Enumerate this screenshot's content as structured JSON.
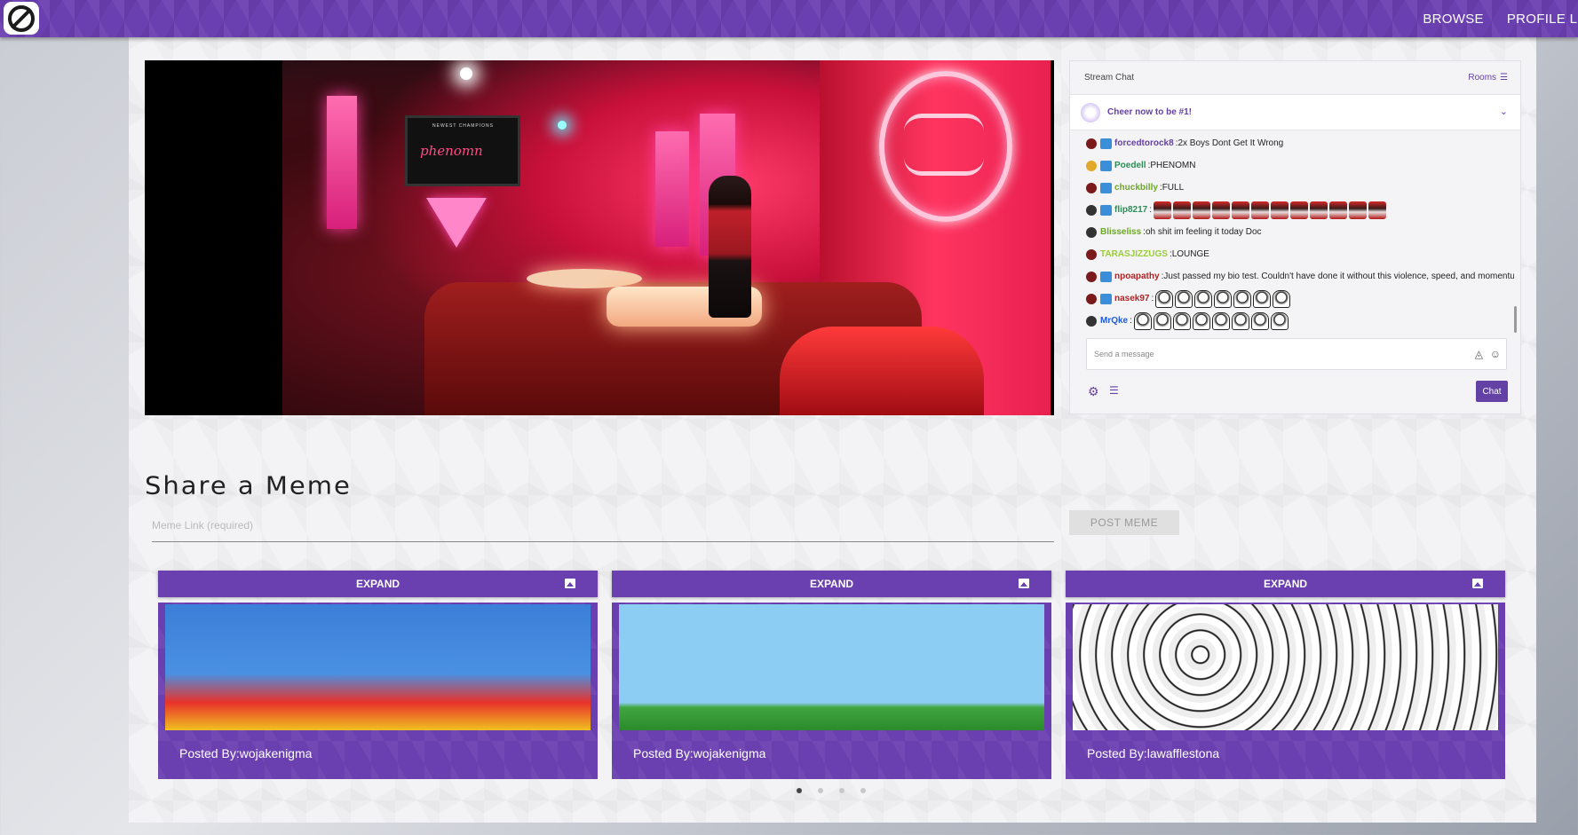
{
  "nav": {
    "browse": "BROWSE",
    "profile": "PROFILE LIS"
  },
  "video": {
    "tv_caption": "NEWEST CHAMPIONS",
    "tv_text": "phenomn"
  },
  "chat": {
    "title": "Stream Chat",
    "rooms": "Rooms",
    "cheer": "Cheer now to be #1!",
    "messages": [
      {
        "user": "forcedtorock8",
        "color": "#6441a4",
        "text": "2x Boys Dont Get It Wrong",
        "emotes": 0,
        "emote_type": "",
        "sub": true,
        "avatar": "#7a1a1a"
      },
      {
        "user": "Poedell",
        "color": "#2e8b57",
        "text": "PHENOMN",
        "emotes": 0,
        "emote_type": "",
        "sub": true,
        "avatar": "#e2a82a"
      },
      {
        "user": "chuckbilly",
        "color": "#6ca824",
        "text": "FULL",
        "emotes": 0,
        "emote_type": "",
        "sub": true,
        "avatar": "#7a1a1a"
      },
      {
        "user": "flip8217",
        "color": "#2e8b57",
        "text": "",
        "emotes": 12,
        "emote_type": "doc",
        "sub": true,
        "avatar": "#333"
      },
      {
        "user": "Blisseliss",
        "color": "#6ca824",
        "text": "oh shit im feeling it today Doc",
        "emotes": 0,
        "emote_type": "",
        "sub": false,
        "avatar": "#333"
      },
      {
        "user": "TARASJIZZUGS",
        "color": "#9acd32",
        "text": "LOUNGE",
        "emotes": 0,
        "emote_type": "",
        "sub": false,
        "avatar": "#7a1a1a"
      },
      {
        "user": "npoapathy",
        "color": "#b22222",
        "text": "Just passed my bio test. Couldn't have done it without this violence, speed, and momentum",
        "emotes": 0,
        "emote_type": "",
        "sub": true,
        "avatar": "#7a1a1a"
      },
      {
        "user": "nasek97",
        "color": "#b22222",
        "text": "",
        "emotes": 7,
        "emote_type": "face",
        "sub": true,
        "avatar": "#7a1a1a"
      },
      {
        "user": "MrQke",
        "color": "#1e5ad6",
        "text": "",
        "emotes": 8,
        "emote_type": "face",
        "sub": false,
        "avatar": "#333"
      }
    ],
    "input_placeholder": "Send a message",
    "send_label": "Chat"
  },
  "share": {
    "title": "Share a Meme",
    "placeholder": "Meme Link (required)",
    "post_label": "POST MEME"
  },
  "cards": [
    {
      "expand": "EXPAND",
      "posted": "Posted By:wojakenigma"
    },
    {
      "expand": "EXPAND",
      "posted": "Posted By:wojakenigma"
    },
    {
      "expand": "EXPAND",
      "posted": "Posted By:lawafflestona"
    }
  ],
  "pagination": {
    "pages": 4,
    "active": 1
  },
  "colors": {
    "brand": "#6a3fb0",
    "chat_accent": "#6441a4"
  }
}
